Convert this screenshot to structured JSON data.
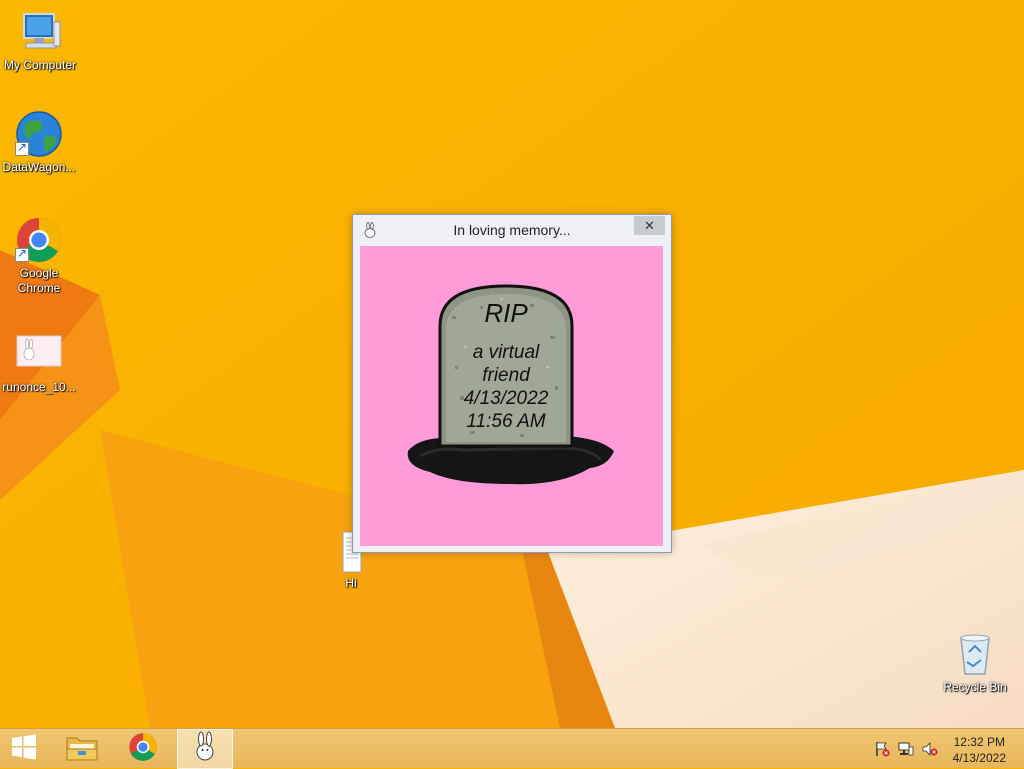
{
  "desktop": {
    "icons": [
      {
        "label": "My Computer",
        "icon": "computer-icon"
      },
      {
        "label": "DataWagon...",
        "icon": "globe-icon"
      },
      {
        "label": "Google Chrome",
        "icon": "chrome-icon"
      },
      {
        "label": "runonce_10...",
        "icon": "image-file-icon"
      },
      {
        "label": "Hi",
        "icon": "text-file-icon"
      },
      {
        "label": "Recycle Bin",
        "icon": "recycle-bin-icon"
      }
    ]
  },
  "window": {
    "title": "In loving memory...",
    "close_glyph": "✕",
    "background_color": "#ff9bd6",
    "tombstone": {
      "line1": "RIP",
      "line2": "a virtual",
      "line3": "friend",
      "line4": "4/13/2022",
      "line5": "11:56 AM"
    }
  },
  "taskbar": {
    "items": [
      {
        "name": "start-button",
        "icon": "windows-logo-icon"
      },
      {
        "name": "file-explorer",
        "icon": "folder-icon"
      },
      {
        "name": "chrome",
        "icon": "chrome-icon"
      },
      {
        "name": "bunny-app",
        "icon": "bunny-icon",
        "active": true
      }
    ],
    "tray": [
      "flag-icon",
      "network-icon",
      "speaker-muted-icon"
    ],
    "clock": {
      "time": "12:32 PM",
      "date": "4/13/2022"
    }
  },
  "colors": {
    "wallpaper": "#f8b400",
    "window_content": "#ff9bd6"
  }
}
